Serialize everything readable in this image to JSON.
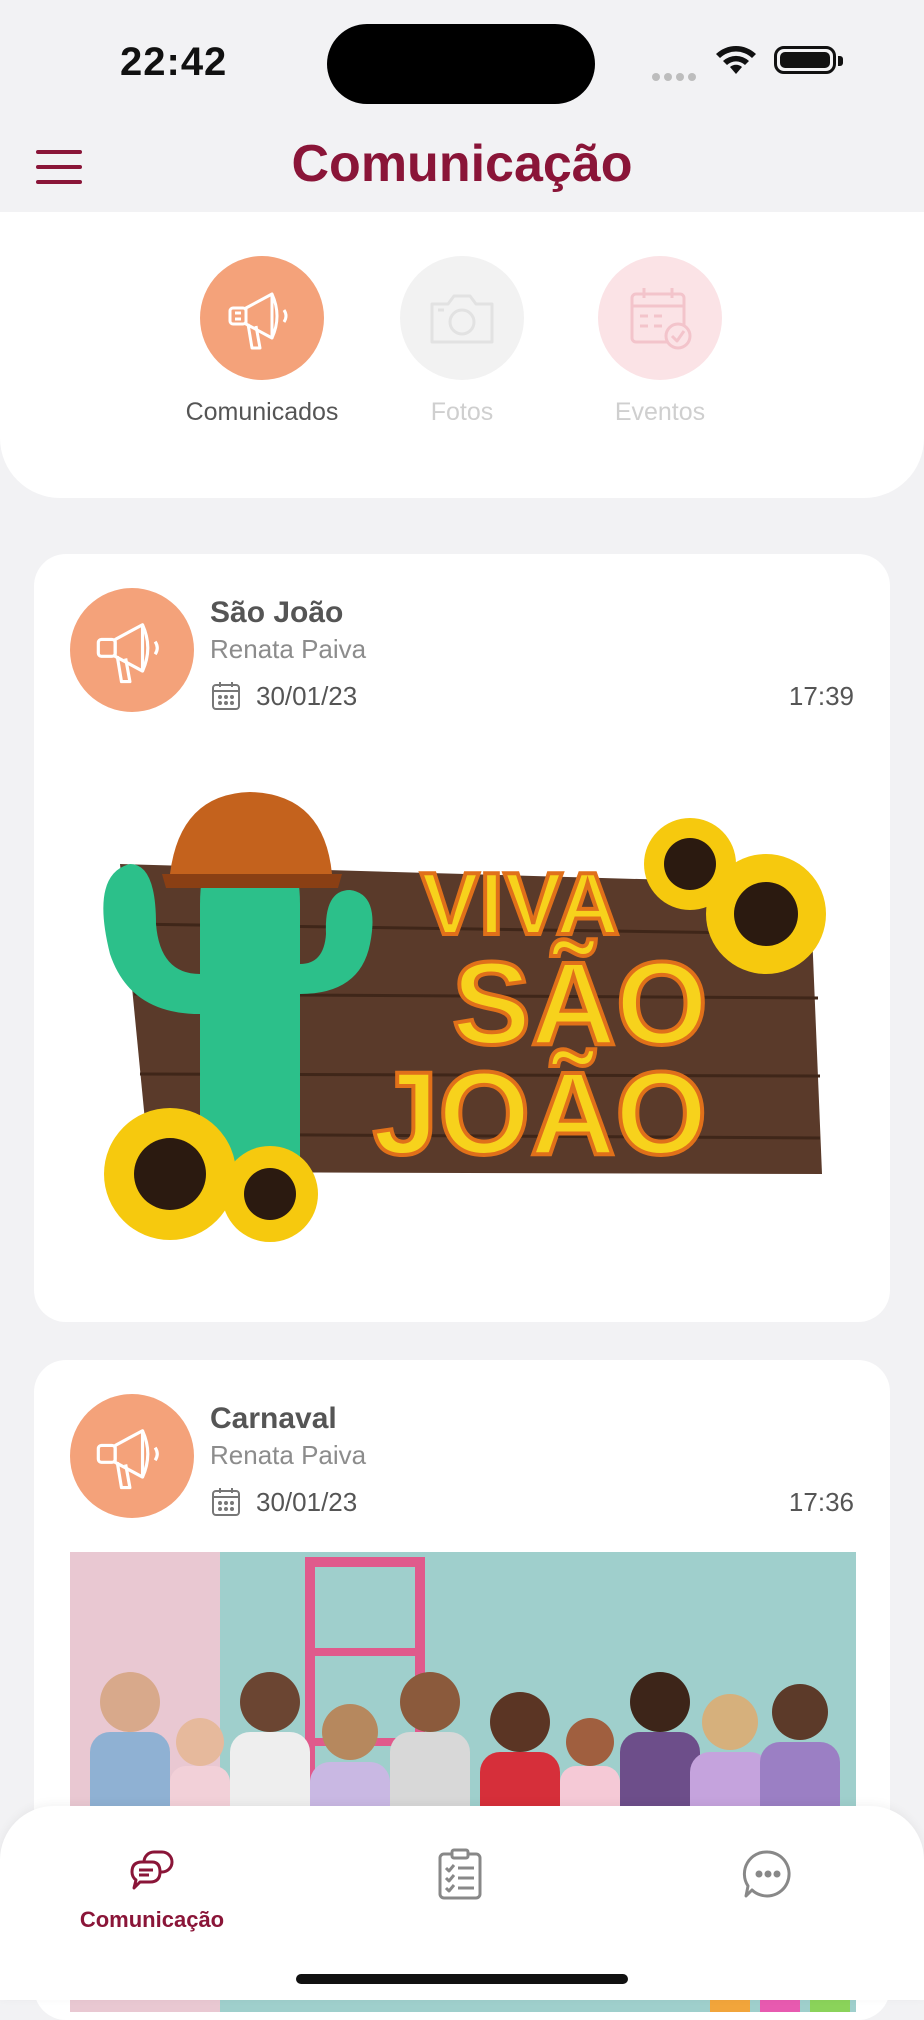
{
  "status_bar": {
    "time": "22:42"
  },
  "header": {
    "title": "Comunicação",
    "menu_icon": "hamburger-menu-icon",
    "accent_color": "#8a1538"
  },
  "categories": [
    {
      "label": "Comunicados",
      "icon": "megaphone-icon",
      "active": true,
      "color": "#f4a27a"
    },
    {
      "label": "Fotos",
      "icon": "camera-icon",
      "active": false,
      "color": "#f2f2f2"
    },
    {
      "label": "Eventos",
      "icon": "calendar-check-icon",
      "active": false,
      "color": "#fbe3e6"
    }
  ],
  "posts": [
    {
      "title": "São João",
      "author": "Renata Paiva",
      "date": "30/01/23",
      "time": "17:39",
      "image_text": {
        "line1": "VIVA",
        "line2": "SÃO",
        "line3": "JOÃO"
      }
    },
    {
      "title": "Carnaval",
      "author": "Renata Paiva",
      "date": "30/01/23",
      "time": "17:36"
    }
  ],
  "bottom_nav": [
    {
      "label": "Comunicação",
      "icon": "chat-bubbles-icon",
      "active": true
    },
    {
      "label": "",
      "icon": "checklist-icon",
      "active": false
    },
    {
      "label": "",
      "icon": "chat-dots-icon",
      "active": false
    }
  ]
}
